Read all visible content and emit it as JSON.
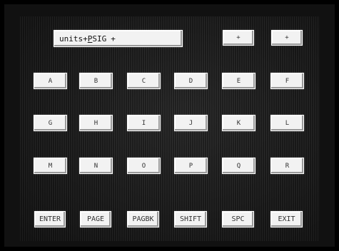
{
  "entry": {
    "label": "units",
    "separator": "+",
    "cursor_char": "P",
    "rest": "SIG",
    "trailing": "+"
  },
  "arrow_keys": {
    "left": "+",
    "right": "+"
  },
  "letter_keys": [
    [
      "A",
      "B",
      "C",
      "D",
      "E",
      "F"
    ],
    [
      "G",
      "H",
      "I",
      "J",
      "K",
      "L"
    ],
    [
      "M",
      "N",
      "O",
      "P",
      "Q",
      "R"
    ]
  ],
  "function_keys": {
    "enter": "ENTER",
    "page": "PAGE",
    "pagebk": "PAGBK",
    "shift": "SHIFT",
    "spc": "SPC",
    "exit": "EXIT"
  }
}
